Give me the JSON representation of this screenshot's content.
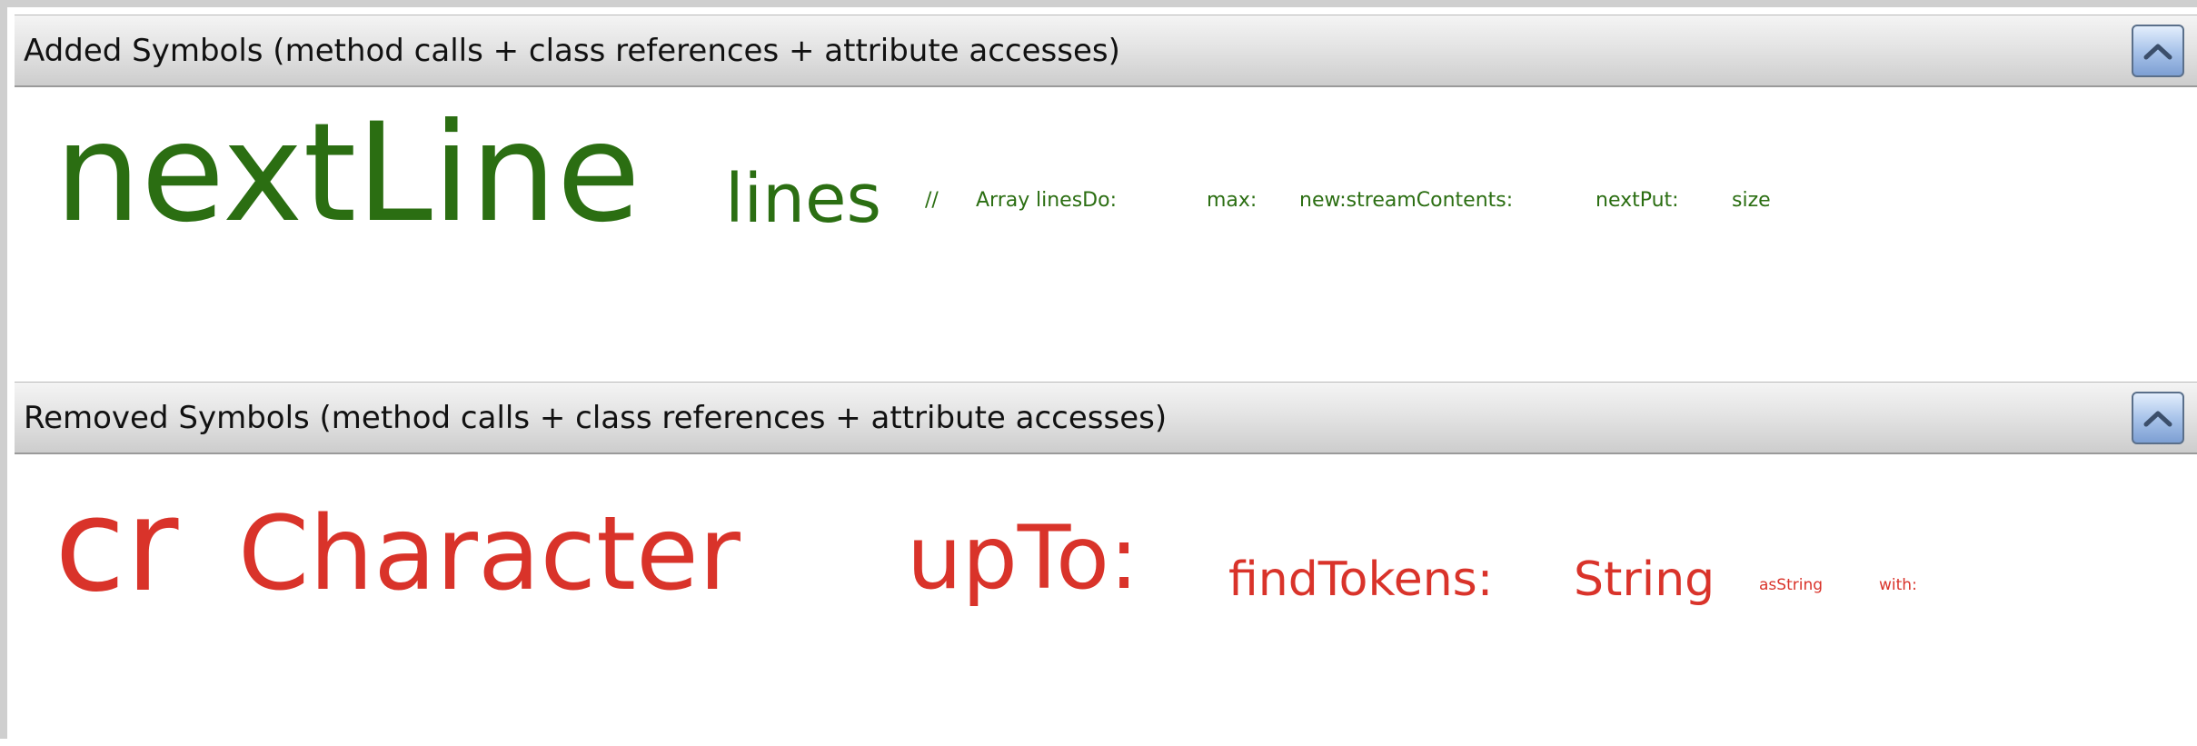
{
  "added_panel": {
    "title": "Added Symbols (method calls + class references + attribute accesses)",
    "collapse_icon": "chevron-up-icon",
    "color": "#2b6e12",
    "words": [
      {
        "text": "nextLine",
        "size": 1
      },
      {
        "text": "lines",
        "size": 2
      },
      {
        "text": "//",
        "size": 3
      },
      {
        "text": "Array",
        "size": 3
      },
      {
        "text": "linesDo:",
        "size": 3
      },
      {
        "text": "max:",
        "size": 3
      },
      {
        "text": "new:streamContents:",
        "size": 3
      },
      {
        "text": "nextPut:",
        "size": 3
      },
      {
        "text": "size",
        "size": 3
      }
    ]
  },
  "removed_panel": {
    "title": "Removed Symbols (method calls + class references + attribute accesses)",
    "collapse_icon": "chevron-up-icon",
    "color": "#d9332a",
    "words": [
      {
        "text": "cr",
        "size": 1
      },
      {
        "text": "Character",
        "size": 2
      },
      {
        "text": "upTo:",
        "size": 3
      },
      {
        "text": "findTokens:",
        "size": 4
      },
      {
        "text": "String",
        "size": 4
      },
      {
        "text": "asString",
        "size": 5
      },
      {
        "text": "with:",
        "size": 5
      }
    ]
  }
}
